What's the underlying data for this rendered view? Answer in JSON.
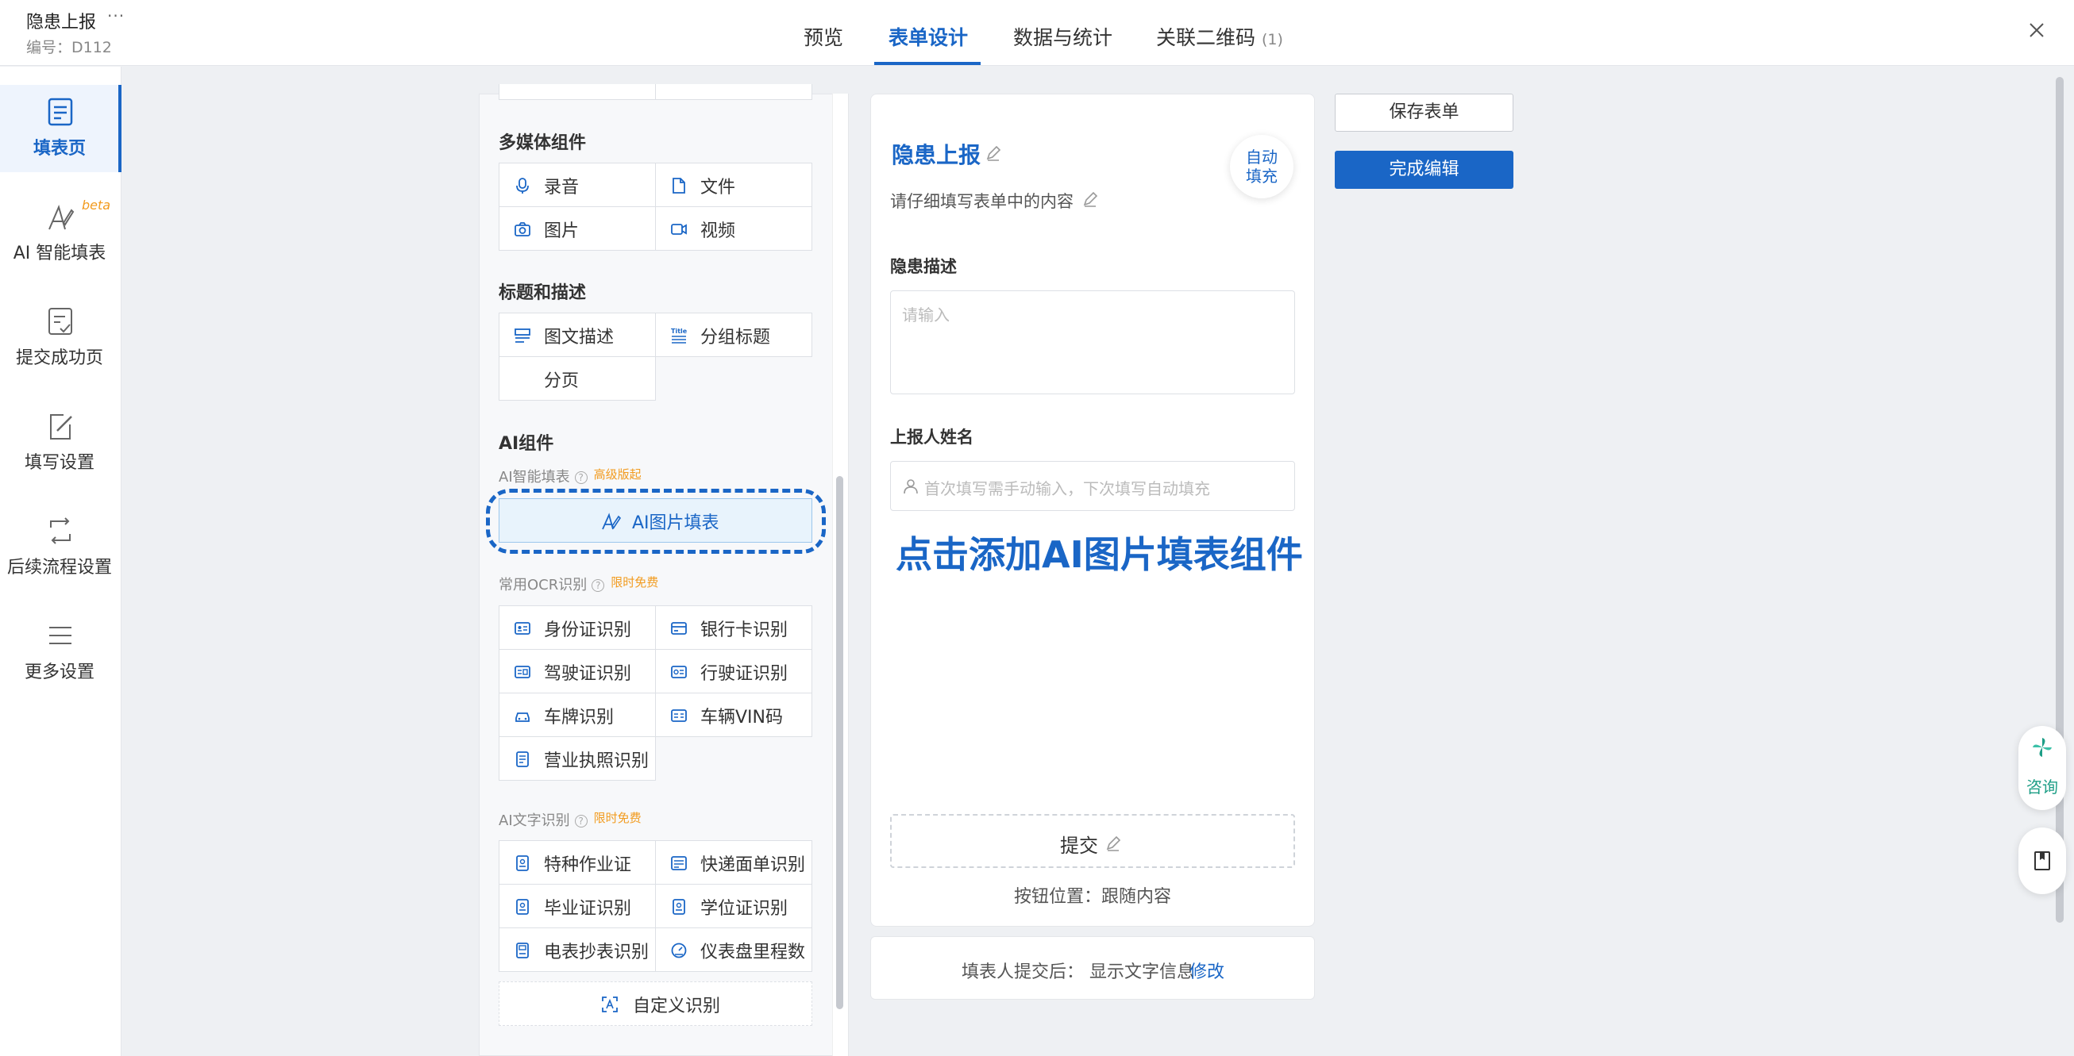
{
  "header": {
    "title": "隐患上报",
    "more": "···",
    "code": "编号：D112",
    "tabs": [
      {
        "label": "预览"
      },
      {
        "label": "表单设计"
      },
      {
        "label": "数据与统计"
      },
      {
        "label": "关联二维码",
        "count": "(1)"
      }
    ]
  },
  "sidebar": {
    "items": [
      {
        "label": "填表页",
        "icon": "form-page-icon"
      },
      {
        "label": "AI 智能填表",
        "icon": "ai-fill-icon",
        "badge": "beta"
      },
      {
        "label": "提交成功页",
        "icon": "submit-success-icon"
      },
      {
        "label": "填写设置",
        "icon": "edit-settings-icon"
      },
      {
        "label": "后续流程设置",
        "icon": "workflow-icon"
      },
      {
        "label": "更多设置",
        "icon": "menu-icon"
      }
    ]
  },
  "components": {
    "multimedia": {
      "title": "多媒体组件",
      "items": [
        "录音",
        "文件",
        "图片",
        "视频"
      ]
    },
    "heading": {
      "title": "标题和描述",
      "items": [
        "图文描述",
        "分组标题",
        "分页"
      ]
    },
    "ai": {
      "title": "AI组件",
      "smart_fill_label": "AI智能填表",
      "smart_fill_tag": "高级版起",
      "image_fill": "AI图片填表",
      "ocr_label": "常用OCR识别",
      "ocr_tag": "限时免费",
      "ocr_items": [
        "身份证识别",
        "银行卡识别",
        "驾驶证识别",
        "行驶证识别",
        "车牌识别",
        "车辆VIN码",
        "营业执照识别"
      ],
      "text_label": "AI文字识别",
      "text_tag": "限时免费",
      "text_items": [
        "特种作业证",
        "快递面单识别",
        "毕业证识别",
        "学位证识别",
        "电表抄表识别",
        "仪表盘里程数"
      ],
      "custom": "自定义识别"
    }
  },
  "form": {
    "title": "隐患上报",
    "description": "请仔细填写表单中的内容",
    "auto_fill": "自动填充",
    "field1_label": "隐患描述",
    "field1_placeholder": "请输入",
    "field2_label": "上报人姓名",
    "field2_placeholder": "首次填写需手动输入，下次填写自动填充",
    "annotation": "点击添加AI图片填表组件",
    "submit": "提交",
    "button_position": "按钮位置：跟随内容",
    "after_submit": "填表人提交后： 显示文字信息",
    "after_submit_link": "修改"
  },
  "actions": {
    "save": "保存表单",
    "finish": "完成编辑"
  },
  "float": {
    "consult": "咨询"
  },
  "colors": {
    "accent": "#1a66c6",
    "tag": "#f29b1f",
    "consult": "#1d9e86"
  }
}
